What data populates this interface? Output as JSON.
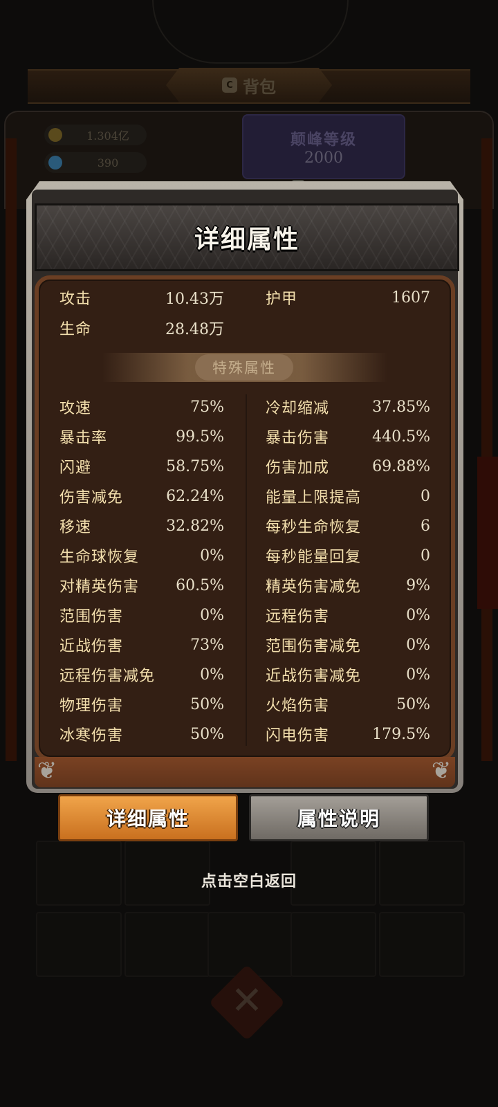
{
  "background": {
    "bag_tab_label": "背包",
    "bag_icon_glyph": "C",
    "resources": [
      {
        "type": "coin",
        "value": "1.304亿",
        "color": "#5a4a1c"
      },
      {
        "type": "gem",
        "value": "390",
        "color": "#2a5a7a"
      }
    ],
    "peak_title": "颠峰等级",
    "peak_level": "2000"
  },
  "dialog": {
    "title": "详细属性",
    "base_stats": [
      {
        "name": "攻击",
        "value": "10.43万"
      },
      {
        "name": "护甲",
        "value": "1607"
      },
      {
        "name": "生命",
        "value": "28.48万"
      }
    ],
    "special_header": "特殊属性",
    "special_stats_left": [
      {
        "name": "攻速",
        "value": "75%"
      },
      {
        "name": "暴击率",
        "value": "99.5%"
      },
      {
        "name": "闪避",
        "value": "58.75%"
      },
      {
        "name": "伤害减免",
        "value": "62.24%"
      },
      {
        "name": "移速",
        "value": "32.82%"
      },
      {
        "name": "生命球恢复",
        "value": "0%"
      },
      {
        "name": "对精英伤害",
        "value": "60.5%"
      },
      {
        "name": "范围伤害",
        "value": "0%"
      },
      {
        "name": "近战伤害",
        "value": "73%"
      },
      {
        "name": "远程伤害减免",
        "value": "0%"
      },
      {
        "name": "物理伤害",
        "value": "50%"
      },
      {
        "name": "冰寒伤害",
        "value": "50%"
      }
    ],
    "special_stats_right": [
      {
        "name": "冷却缩减",
        "value": "37.85%"
      },
      {
        "name": "暴击伤害",
        "value": "440.5%"
      },
      {
        "name": "伤害加成",
        "value": "69.88%"
      },
      {
        "name": "能量上限提高",
        "value": "0"
      },
      {
        "name": "每秒生命恢复",
        "value": "6"
      },
      {
        "name": "每秒能量回复",
        "value": "0"
      },
      {
        "name": "精英伤害减免",
        "value": "9%"
      },
      {
        "name": "远程伤害",
        "value": "0%"
      },
      {
        "name": "范围伤害减免",
        "value": "0%"
      },
      {
        "name": "近战伤害减免",
        "value": "0%"
      },
      {
        "name": "火焰伤害",
        "value": "50%"
      },
      {
        "name": "闪电伤害",
        "value": "179.5%"
      }
    ]
  },
  "tabs": {
    "detail_label": "详细属性",
    "explain_label": "属性说明"
  },
  "hint_text": "点击空白返回"
}
